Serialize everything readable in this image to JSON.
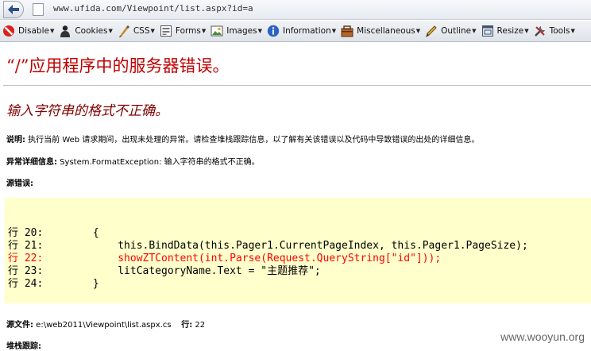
{
  "browser": {
    "url": "www.ufida.com/Viewpoint/list.aspx?id=a"
  },
  "toolbar": {
    "items": [
      {
        "label": "Disable",
        "icon": "disable-icon"
      },
      {
        "label": "Cookies",
        "icon": "cookies-icon"
      },
      {
        "label": "CSS",
        "icon": "css-icon"
      },
      {
        "label": "Forms",
        "icon": "forms-icon"
      },
      {
        "label": "Images",
        "icon": "images-icon"
      },
      {
        "label": "Information",
        "icon": "information-icon"
      },
      {
        "label": "Miscellaneous",
        "icon": "miscellaneous-icon"
      },
      {
        "label": "Outline",
        "icon": "outline-icon"
      },
      {
        "label": "Resize",
        "icon": "resize-icon"
      },
      {
        "label": "Tools",
        "icon": "tools-icon"
      }
    ]
  },
  "error": {
    "title": "“/”应用程序中的服务器错误。",
    "subtitle": "输入字符串的格式不正确。",
    "description_label": "说明:",
    "description_text": " 执行当前 Web 请求期间，出现未处理的异常。请检查堆栈跟踪信息，以了解有关该错误以及代码中导致错误的出处的详细信息。",
    "exception_label": "异常详细信息:",
    "exception_text": " System.FormatException: 输入字符串的格式不正确。",
    "source_error_label": "源错误:",
    "code_lines": [
      {
        "text": "行 20:        {",
        "error": false
      },
      {
        "text": "行 21:            this.BindData(this.Pager1.CurrentPageIndex, this.Pager1.PageSize);",
        "error": false
      },
      {
        "text": "行 22:            showZTContent(int.Parse(Request.QueryString[\"id\"]));",
        "error": true
      },
      {
        "text": "行 23:            litCategoryName.Text = \"主题推荐\";",
        "error": false
      },
      {
        "text": "行 24:        }",
        "error": false
      }
    ],
    "source_file_label": "源文件:",
    "source_file_path": " e:\\web2011\\Viewpoint\\list.aspx.cs",
    "line_label": "行:",
    "line_number": " 22",
    "stack_trace_label": "堆栈跟踪:"
  },
  "watermark": "www.wooyun.org",
  "colors": {
    "title": "#c00000",
    "subtitle": "#800000",
    "code_bg": "#ffffcc",
    "code_error": "#ff0000"
  }
}
